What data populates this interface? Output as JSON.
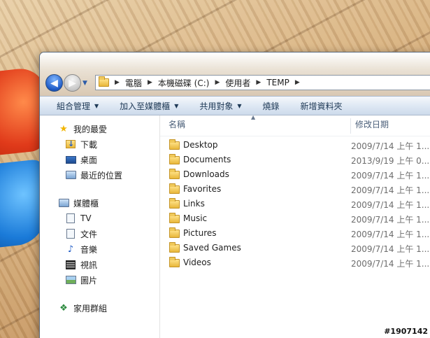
{
  "address": {
    "crumbs": [
      "電腦",
      "本機磁碟 (C:)",
      "使用者",
      "TEMP"
    ]
  },
  "toolbar": {
    "organize": "組合管理",
    "include_library": "加入至媒體櫃",
    "share_with": "共用對象",
    "burn": "燒錄",
    "new_folder": "新增資料夾"
  },
  "nav": {
    "favorites": {
      "label": "我的最愛",
      "items": [
        "下載",
        "桌面",
        "最近的位置"
      ]
    },
    "libraries": {
      "label": "媒體櫃",
      "items": [
        "TV",
        "文件",
        "音樂",
        "視訊",
        "圖片"
      ]
    },
    "homegroup": {
      "label": "家用群組"
    }
  },
  "columns": {
    "name": "名稱",
    "date": "修改日期"
  },
  "files": [
    {
      "name": "Desktop",
      "date": "2009/7/14 上午 1..."
    },
    {
      "name": "Documents",
      "date": "2013/9/19 上午 0..."
    },
    {
      "name": "Downloads",
      "date": "2009/7/14 上午 1..."
    },
    {
      "name": "Favorites",
      "date": "2009/7/14 上午 1..."
    },
    {
      "name": "Links",
      "date": "2009/7/14 上午 1..."
    },
    {
      "name": "Music",
      "date": "2009/7/14 上午 1..."
    },
    {
      "name": "Pictures",
      "date": "2009/7/14 上午 1..."
    },
    {
      "name": "Saved Games",
      "date": "2009/7/14 上午 1..."
    },
    {
      "name": "Videos",
      "date": "2009/7/14 上午 1..."
    }
  ],
  "watermark": "#1907142"
}
